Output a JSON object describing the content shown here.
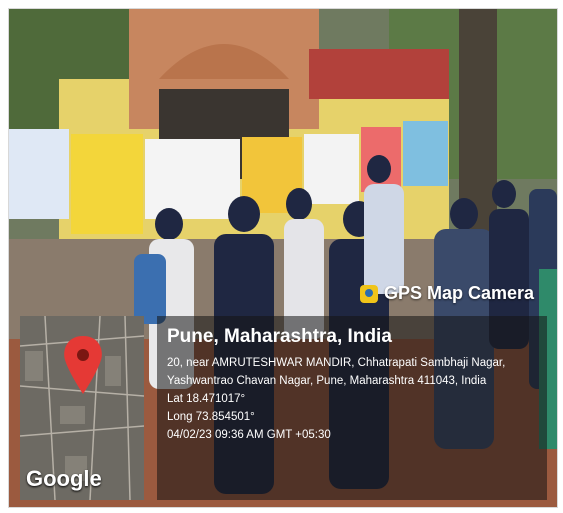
{
  "stamp": {
    "app_name": "GPS Map Camera",
    "location_title": "Pune, Maharashtra, India",
    "address_line1": "20, near AMRUTESHWAR MANDIR, Chhatrapati Sambhaji Nagar,",
    "address_line2": "Yashwantrao Chavan Nagar, Pune, Maharashtra 411043, India",
    "lat": "Lat 18.471017°",
    "long": "Long 73.854501°",
    "datetime": "04/02/23 09:36 AM GMT +05:30"
  },
  "map": {
    "provider": "Google",
    "pin_color": "#e53935",
    "icon": "location-pin-icon"
  },
  "colors": {
    "overlay": "#141414",
    "pin": "#e53935",
    "logo": "#f0c419"
  }
}
